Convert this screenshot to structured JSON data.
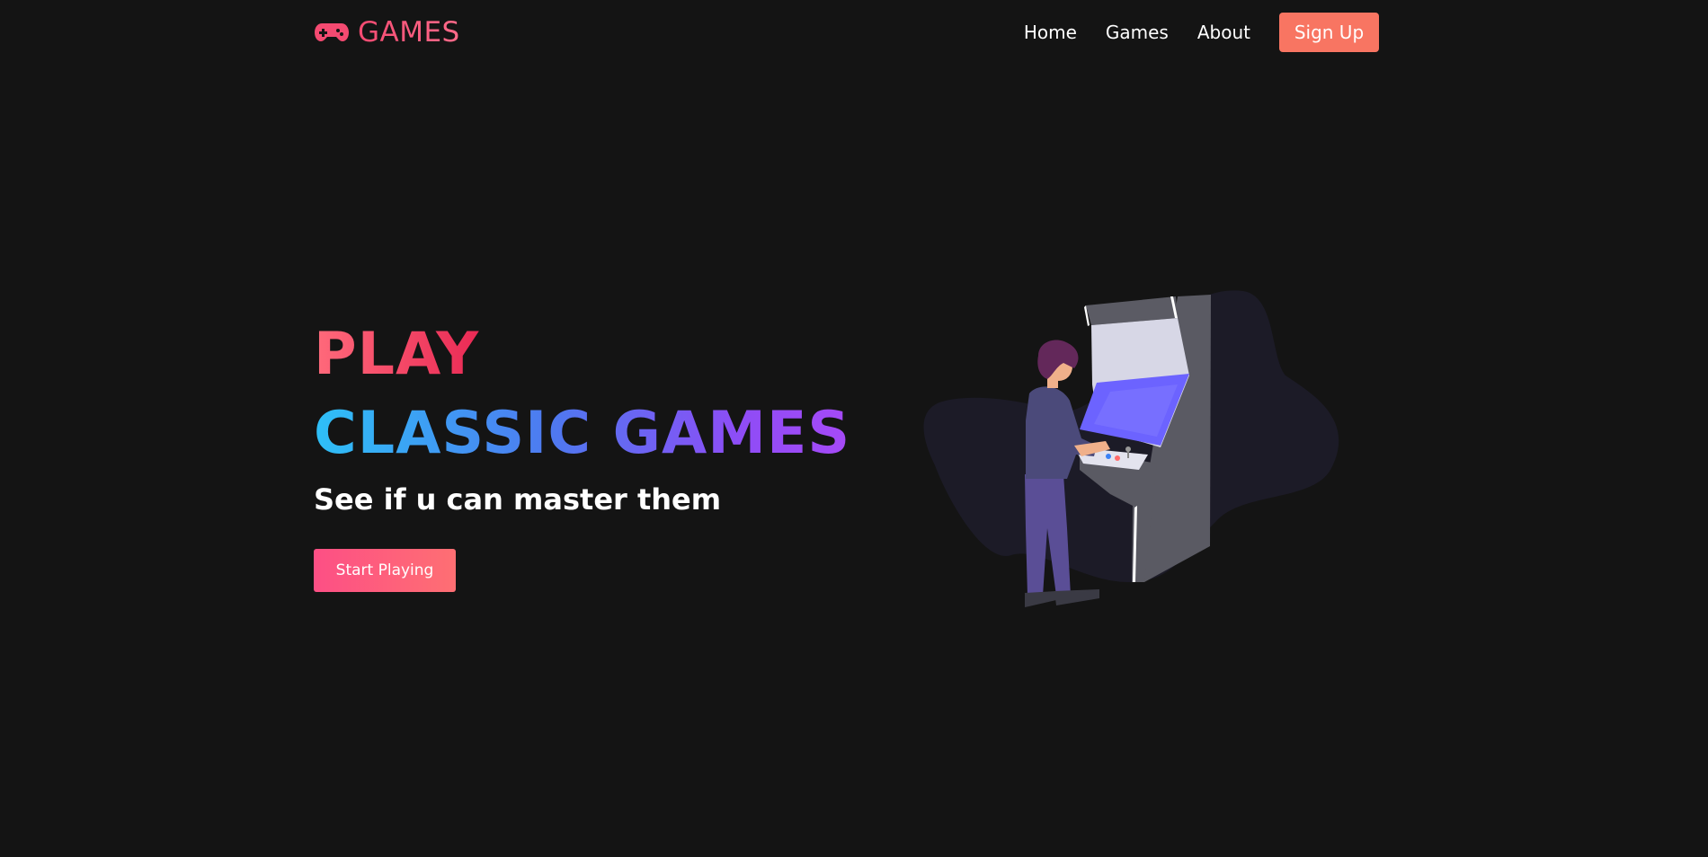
{
  "navbar": {
    "brand_icon": "gamepad-icon",
    "brand_text": "GAMES",
    "links": [
      {
        "label": "Home"
      },
      {
        "label": "Games"
      },
      {
        "label": "About"
      }
    ],
    "signup_label": "Sign Up"
  },
  "hero": {
    "title_line1": "PLAY",
    "title_line2": "CLASSIC GAMES",
    "subtitle": "See if u can master them",
    "cta_label": "Start Playing"
  },
  "illustration": {
    "subject": "arcade-player-illustration"
  },
  "colors": {
    "background": "#141414",
    "accent": "#f87562",
    "brand_pink": "#f44a71",
    "gradient_blue": "#2ec0f7",
    "gradient_purple": "#a64af7"
  }
}
